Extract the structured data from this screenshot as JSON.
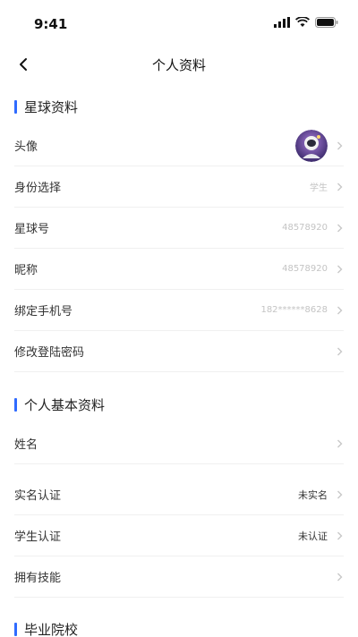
{
  "status": {
    "time": "9:41"
  },
  "nav": {
    "title": "个人资料"
  },
  "sections": {
    "planet": "星球资料",
    "basic": "个人基本资料",
    "school": "毕业院校"
  },
  "rows": {
    "avatar": {
      "label": "头像"
    },
    "identity": {
      "label": "身份选择",
      "value": "学生"
    },
    "planet_no": {
      "label": "星球号",
      "value": "48578920"
    },
    "nickname": {
      "label": "昵称",
      "value": "48578920"
    },
    "phone": {
      "label": "绑定手机号",
      "value": "182******8628"
    },
    "password": {
      "label": "修改登陆密码"
    },
    "name": {
      "label": "姓名"
    },
    "realname": {
      "label": "实名认证",
      "value": "未实名"
    },
    "student": {
      "label": "学生认证",
      "value": "未认证"
    },
    "skills": {
      "label": "拥有技能"
    }
  },
  "colors": {
    "accent": "#2f6bff"
  },
  "icons": {
    "back": "chevron-left-icon",
    "chevron": "chevron-right-icon",
    "signal": "signal-icon",
    "wifi": "wifi-icon",
    "battery": "battery-icon"
  }
}
